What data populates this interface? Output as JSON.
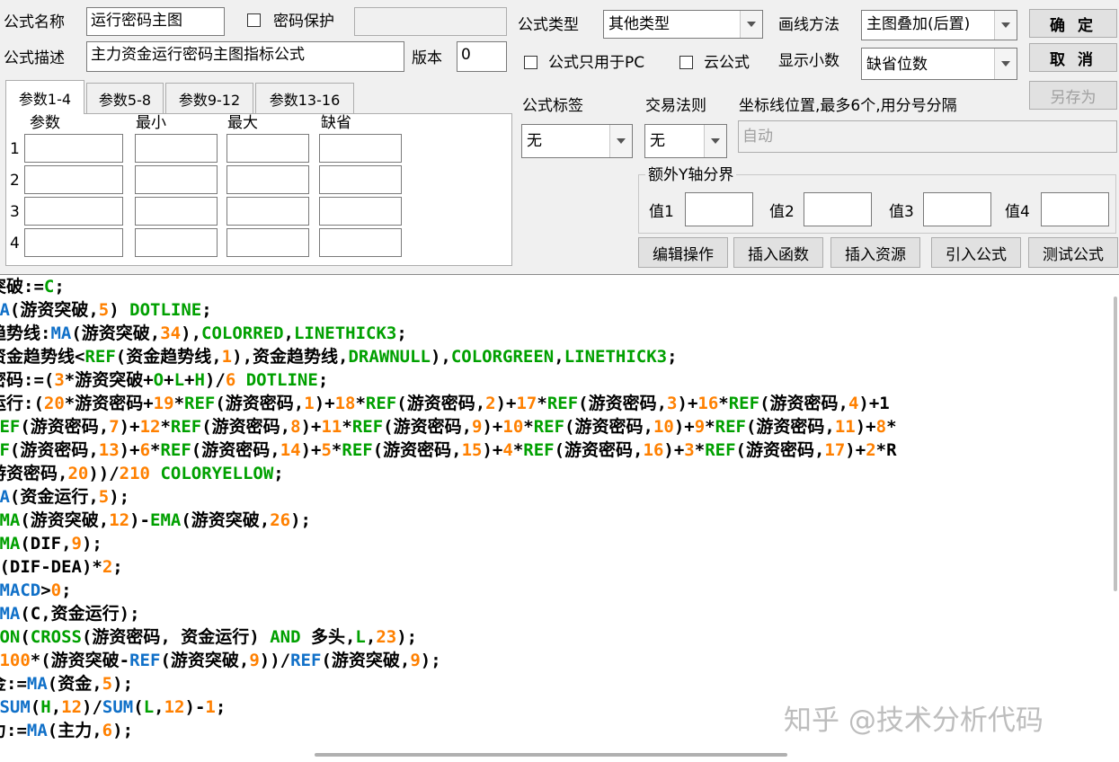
{
  "header": {
    "name_label": "公式名称",
    "name_value": "运行密码主图",
    "password_protect_label": "密码保护",
    "desc_label": "公式描述",
    "desc_value": "主力资金运行密码主图指标公式",
    "version_label": "版本",
    "version_value": "0",
    "type_label": "公式类型",
    "type_value": "其他类型",
    "pc_only_label": "公式只用于PC",
    "cloud_label": "云公式",
    "draw_method_label": "画线方法",
    "draw_method_value": "主图叠加(后置)",
    "decimal_label": "显示小数",
    "decimal_value": "缺省位数"
  },
  "buttons": {
    "ok": "确 定",
    "cancel": "取 消",
    "save_as": "另存为"
  },
  "tabs": [
    "参数1-4",
    "参数5-8",
    "参数9-12",
    "参数13-16"
  ],
  "params": {
    "headers": [
      "参数",
      "最小",
      "最大",
      "缺省"
    ],
    "rows": [
      "1",
      "2",
      "3",
      "4"
    ]
  },
  "tags": {
    "formula_tag_label": "公式标签",
    "formula_tag_value": "无",
    "trade_rule_label": "交易法则",
    "trade_rule_value": "无",
    "axis_label": "坐标线位置,最多6个,用分号分隔",
    "axis_value": "自动"
  },
  "extra_y": {
    "group_label": "额外Y轴分界",
    "v1": "值1",
    "v2": "值2",
    "v3": "值3",
    "v4": "值4"
  },
  "actions": [
    "编辑操作",
    "插入函数",
    "插入资源",
    "引入公式",
    "测试公式"
  ],
  "watermark": "知乎 @技术分析代码",
  "colors": {
    "func": "#1070c8",
    "num": "#ff8000",
    "keyword": "#00a000",
    "text": "#000000"
  },
  "code_lines": [
    [
      [
        "突破:=",
        "t"
      ],
      [
        "C",
        "k"
      ],
      [
        ";",
        "t"
      ]
    ],
    [
      [
        "MA",
        "f"
      ],
      [
        "(游资突破,",
        "t"
      ],
      [
        "5",
        "n"
      ],
      [
        ") ",
        "t"
      ],
      [
        "DOTLINE",
        "k"
      ],
      [
        ";",
        "t"
      ]
    ],
    [
      [
        "趋势线:",
        "t"
      ],
      [
        "MA",
        "f"
      ],
      [
        "(游资突破,",
        "t"
      ],
      [
        "34",
        "n"
      ],
      [
        "),",
        "t"
      ],
      [
        "COLORRED",
        "k"
      ],
      [
        ",",
        "t"
      ],
      [
        "LINETHICK3",
        "k"
      ],
      [
        ";",
        "t"
      ]
    ],
    [
      [
        "资金趋势线<",
        "t"
      ],
      [
        "REF",
        "k"
      ],
      [
        "(资金趋势线,",
        "t"
      ],
      [
        "1",
        "n"
      ],
      [
        "),资金趋势线,",
        "t"
      ],
      [
        "DRAWNULL",
        "k"
      ],
      [
        "),",
        "t"
      ],
      [
        "COLORGREEN",
        "k"
      ],
      [
        ",",
        "t"
      ],
      [
        "LINETHICK3",
        "k"
      ],
      [
        ";",
        "t"
      ]
    ],
    [
      [
        "密码:=(",
        "t"
      ],
      [
        "3",
        "n"
      ],
      [
        "*游资突破+",
        "t"
      ],
      [
        "O",
        "k"
      ],
      [
        "+",
        "t"
      ],
      [
        "L",
        "k"
      ],
      [
        "+",
        "t"
      ],
      [
        "H",
        "k"
      ],
      [
        ")/",
        "t"
      ],
      [
        "6",
        "n"
      ],
      [
        " ",
        "t"
      ],
      [
        "DOTLINE",
        "k"
      ],
      [
        ";",
        "t"
      ]
    ],
    [
      [
        "运行:(",
        "t"
      ],
      [
        "20",
        "n"
      ],
      [
        "*游资密码+",
        "t"
      ],
      [
        "19",
        "n"
      ],
      [
        "*",
        "t"
      ],
      [
        "REF",
        "k"
      ],
      [
        "(游资密码,",
        "t"
      ],
      [
        "1",
        "n"
      ],
      [
        ")+",
        "t"
      ],
      [
        "18",
        "n"
      ],
      [
        "*",
        "t"
      ],
      [
        "REF",
        "k"
      ],
      [
        "(游资密码,",
        "t"
      ],
      [
        "2",
        "n"
      ],
      [
        ")+",
        "t"
      ],
      [
        "17",
        "n"
      ],
      [
        "*",
        "t"
      ],
      [
        "REF",
        "k"
      ],
      [
        "(游资密码,",
        "t"
      ],
      [
        "3",
        "n"
      ],
      [
        ")+",
        "t"
      ],
      [
        "16",
        "n"
      ],
      [
        "*",
        "t"
      ],
      [
        "REF",
        "k"
      ],
      [
        "(游资密码,",
        "t"
      ],
      [
        "4",
        "n"
      ],
      [
        ")+1",
        "t"
      ]
    ],
    [
      [
        "REF",
        "k"
      ],
      [
        "(游资密码,",
        "t"
      ],
      [
        "7",
        "n"
      ],
      [
        ")+",
        "t"
      ],
      [
        "12",
        "n"
      ],
      [
        "*",
        "t"
      ],
      [
        "REF",
        "k"
      ],
      [
        "(游资密码,",
        "t"
      ],
      [
        "8",
        "n"
      ],
      [
        ")+",
        "t"
      ],
      [
        "11",
        "n"
      ],
      [
        "*",
        "t"
      ],
      [
        "REF",
        "k"
      ],
      [
        "(游资密码,",
        "t"
      ],
      [
        "9",
        "n"
      ],
      [
        ")+",
        "t"
      ],
      [
        "10",
        "n"
      ],
      [
        "*",
        "t"
      ],
      [
        "REF",
        "k"
      ],
      [
        "(游资密码,",
        "t"
      ],
      [
        "10",
        "n"
      ],
      [
        ")+",
        "t"
      ],
      [
        "9",
        "n"
      ],
      [
        "*",
        "t"
      ],
      [
        "REF",
        "k"
      ],
      [
        "(游资密码,",
        "t"
      ],
      [
        "11",
        "n"
      ],
      [
        ")+",
        "t"
      ],
      [
        "8",
        "n"
      ],
      [
        "*",
        "t"
      ]
    ],
    [
      [
        "EF",
        "k"
      ],
      [
        "(游资密码,",
        "t"
      ],
      [
        "13",
        "n"
      ],
      [
        ")+",
        "t"
      ],
      [
        "6",
        "n"
      ],
      [
        "*",
        "t"
      ],
      [
        "REF",
        "k"
      ],
      [
        "(游资密码,",
        "t"
      ],
      [
        "14",
        "n"
      ],
      [
        ")+",
        "t"
      ],
      [
        "5",
        "n"
      ],
      [
        "*",
        "t"
      ],
      [
        "REF",
        "k"
      ],
      [
        "(游资密码,",
        "t"
      ],
      [
        "15",
        "n"
      ],
      [
        ")+",
        "t"
      ],
      [
        "4",
        "n"
      ],
      [
        "*",
        "t"
      ],
      [
        "REF",
        "k"
      ],
      [
        "(游资密码,",
        "t"
      ],
      [
        "16",
        "n"
      ],
      [
        ")+",
        "t"
      ],
      [
        "3",
        "n"
      ],
      [
        "*",
        "t"
      ],
      [
        "REF",
        "k"
      ],
      [
        "(游资密码,",
        "t"
      ],
      [
        "17",
        "n"
      ],
      [
        ")+",
        "t"
      ],
      [
        "2",
        "n"
      ],
      [
        "*R",
        "t"
      ]
    ],
    [
      [
        "游资密码,",
        "t"
      ],
      [
        "20",
        "n"
      ],
      [
        "))/",
        "t"
      ],
      [
        "210",
        "n"
      ],
      [
        " ",
        "t"
      ],
      [
        "COLORYELLOW",
        "k"
      ],
      [
        ";",
        "t"
      ]
    ],
    [
      [
        "MA",
        "f"
      ],
      [
        "(资金运行,",
        "t"
      ],
      [
        "5",
        "n"
      ],
      [
        ");",
        "t"
      ]
    ],
    [
      [
        "EMA",
        "k"
      ],
      [
        "(游资突破,",
        "t"
      ],
      [
        "12",
        "n"
      ],
      [
        ")-",
        "t"
      ],
      [
        "EMA",
        "k"
      ],
      [
        "(游资突破,",
        "t"
      ],
      [
        "26",
        "n"
      ],
      [
        ");",
        "t"
      ]
    ],
    [
      [
        "EMA",
        "k"
      ],
      [
        "(DIF,",
        "t"
      ],
      [
        "9",
        "n"
      ],
      [
        ");",
        "t"
      ]
    ],
    [
      [
        "=(DIF-DEA)*",
        "t"
      ],
      [
        "2",
        "n"
      ],
      [
        ";",
        "t"
      ]
    ],
    [
      [
        "=",
        "t"
      ],
      [
        "MACD",
        "f"
      ],
      [
        ">",
        "t"
      ],
      [
        "0",
        "n"
      ],
      [
        ";",
        "t"
      ]
    ],
    [
      [
        ">",
        "t"
      ],
      [
        "MA",
        "f"
      ],
      [
        "(C,资金运行);",
        "t"
      ]
    ],
    [
      [
        "CON",
        "k"
      ],
      [
        "(",
        "t"
      ],
      [
        "CROSS",
        "k"
      ],
      [
        "(游资密码, 资金运行) ",
        "t"
      ],
      [
        "AND",
        "k"
      ],
      [
        " 多头,",
        "t"
      ],
      [
        "L",
        "k"
      ],
      [
        ",",
        "t"
      ],
      [
        "23",
        "n"
      ],
      [
        ");",
        "t"
      ]
    ],
    [
      [
        "=",
        "t"
      ],
      [
        "100",
        "n"
      ],
      [
        "*(游资突破-",
        "t"
      ],
      [
        "REF",
        "f"
      ],
      [
        "(游资突破,",
        "t"
      ],
      [
        "9",
        "n"
      ],
      [
        "))/",
        "t"
      ],
      [
        "REF",
        "f"
      ],
      [
        "(游资突破,",
        "t"
      ],
      [
        "9",
        "n"
      ],
      [
        ");",
        "t"
      ]
    ],
    [
      [
        "金:=",
        "t"
      ],
      [
        "MA",
        "f"
      ],
      [
        "(资金,",
        "t"
      ],
      [
        "5",
        "n"
      ],
      [
        ");",
        "t"
      ]
    ],
    [
      [
        "=",
        "t"
      ],
      [
        "SUM",
        "f"
      ],
      [
        "(",
        "t"
      ],
      [
        "H",
        "k"
      ],
      [
        ",",
        "t"
      ],
      [
        "12",
        "n"
      ],
      [
        ")/",
        "t"
      ],
      [
        "SUM",
        "f"
      ],
      [
        "(",
        "t"
      ],
      [
        "L",
        "k"
      ],
      [
        ",",
        "t"
      ],
      [
        "12",
        "n"
      ],
      [
        ")-",
        "t"
      ],
      [
        "1",
        "n"
      ],
      [
        ";",
        "t"
      ]
    ],
    [
      [
        "力:=",
        "t"
      ],
      [
        "MA",
        "f"
      ],
      [
        "(主力,",
        "t"
      ],
      [
        "6",
        "n"
      ],
      [
        ");",
        "t"
      ]
    ]
  ]
}
